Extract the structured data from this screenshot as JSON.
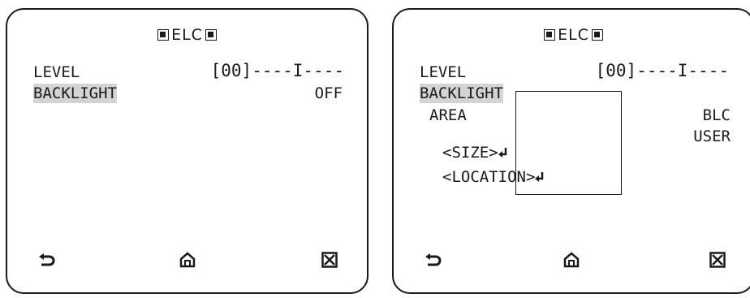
{
  "left_screen": {
    "title": "ELC",
    "level_label": "LEVEL",
    "level_value": "[00]----I----",
    "backlight_label": "BACKLIGHT",
    "backlight_value": "OFF",
    "icons": [
      "back-icon",
      "home-icon",
      "close-box-icon"
    ]
  },
  "right_screen": {
    "title": "ELC",
    "level_label": "LEVEL",
    "level_value": "[00]----I----",
    "backlight_label": "BACKLIGHT",
    "backlight_value": "BLC",
    "area_label": "AREA",
    "area_value": "USER",
    "size_label": "<SIZE>",
    "location_label": "<LOCATION>",
    "icons": [
      "back-icon",
      "home-icon",
      "close-box-icon",
      "enter-icon"
    ]
  }
}
